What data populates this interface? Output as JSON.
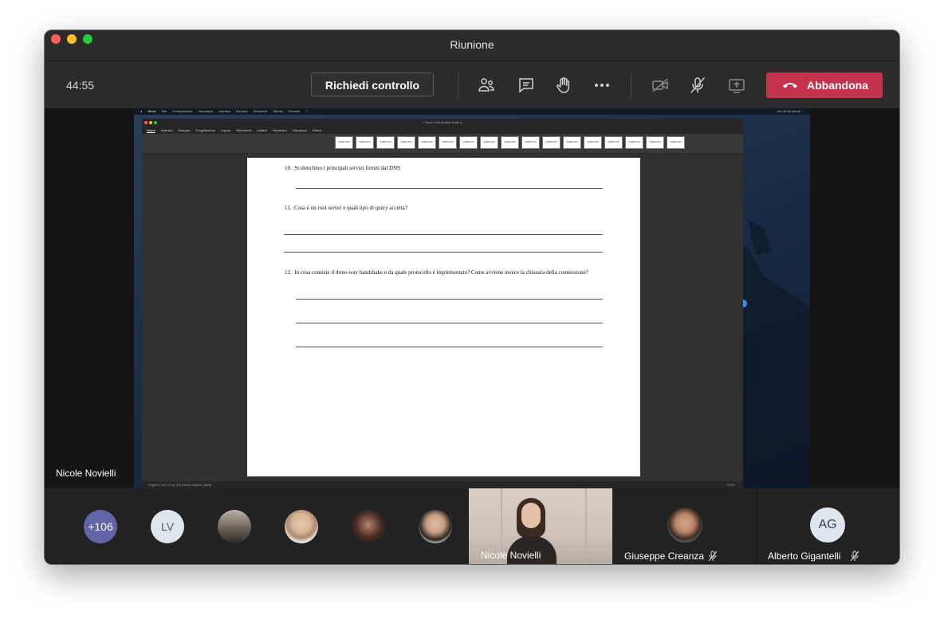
{
  "window": {
    "title": "Riunione"
  },
  "toolbar": {
    "timer": "44:55",
    "request_control_label": "Richiedi controllo",
    "leave_label": "Abbandona",
    "leave_color": "#c4314b",
    "icons": [
      "participants-icon",
      "chat-icon",
      "raise-hand-icon",
      "more-icon",
      "camera-off-icon",
      "mic-off-icon",
      "share-tray-icon"
    ]
  },
  "shared_screen": {
    "presenter": "Nicole Novielli",
    "mac_menubar": {
      "items": [
        "Word",
        "File",
        "Composizione",
        "Visualizza",
        "Inserisci",
        "Formato",
        "Strumenti",
        "Tabella",
        "Finestra",
        "?"
      ],
      "clock": "Gio 16:45  Nicole"
    },
    "word": {
      "document_title": "I Turno // Novembre finale A",
      "tabs": [
        "Home",
        "Inserisci",
        "Disegno",
        "Progettazione",
        "Layout",
        "Riferimenti",
        "Lettere",
        "Revisione",
        "Visualizza",
        "Dimmi"
      ],
      "style_gallery": [
        "AaBbCcDd",
        "AaBbCcDd",
        "AaBbCcDd",
        "AaBbCcDd",
        "AaBbCcDd",
        "AaBbCcDd",
        "AaBbCcDd",
        "AaBbCcDd",
        "AaBbCcDd",
        "AaBbCcDd",
        "AaBbCcDd",
        "AaBbCcDd",
        "AaBbCcDd",
        "AaBbCcDd",
        "AaBbCcDd",
        "AaBbCcDd",
        "AaBbCcDd"
      ],
      "statusbar_left": "Pagina 2 di 2   29 di 376 parole   Italiano (Italia)",
      "statusbar_right": "100%",
      "questions": [
        {
          "number": "10.",
          "text": "Si elenchino i principali servizi forniti dal DNS"
        },
        {
          "number": "11.",
          "text": "Cosa è un root server e quali tipo di query accetta?"
        },
        {
          "number": "12.",
          "text": "In cosa consiste il three-way handshake e da quale protocollo è implementato? Come avviene invece la chiusura della connessione?"
        }
      ]
    }
  },
  "participants": {
    "overflow_count": "+106",
    "overflow_color": "#6264a7",
    "initials_lv": "LV",
    "initials_ag": "AG",
    "video_tiles": [
      {
        "name": "Nicole Novielli"
      },
      {
        "name": "Giuseppe Creanza",
        "muted": true
      },
      {
        "name": "Alberto Gigantelli",
        "muted": true
      }
    ]
  }
}
